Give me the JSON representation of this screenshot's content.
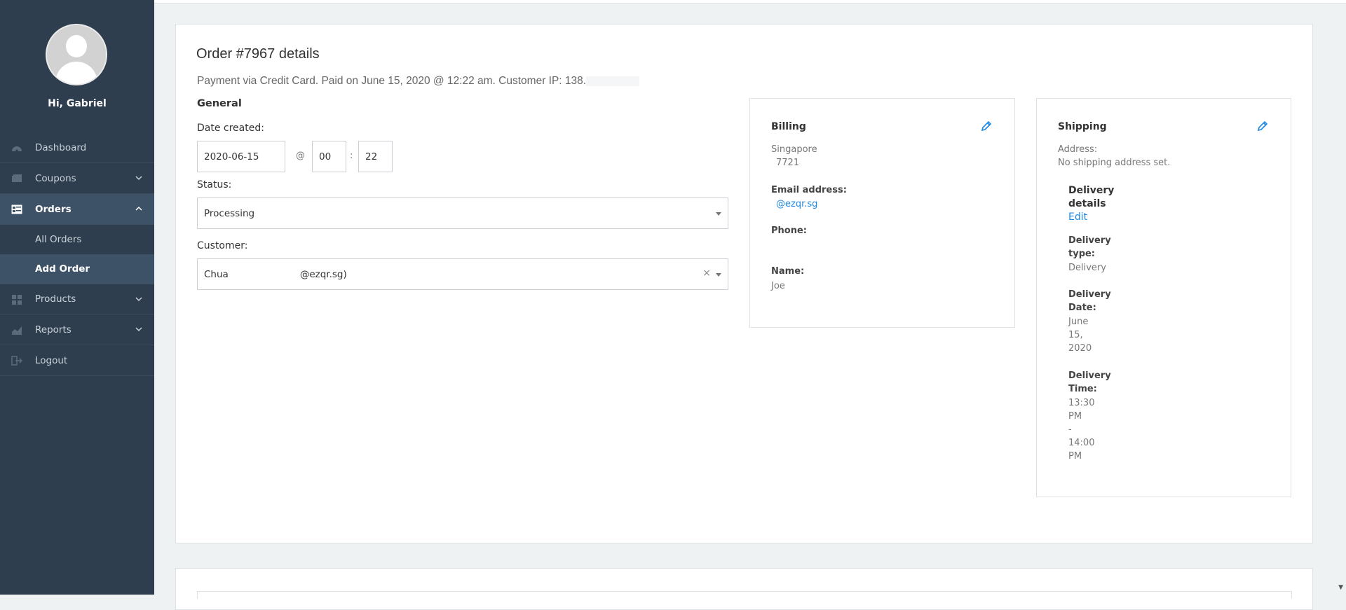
{
  "sidebar": {
    "greeting": "Hi, Gabriel",
    "items": [
      {
        "label": "Dashboard",
        "icon": "dashboard-icon"
      },
      {
        "label": "Coupons",
        "icon": "coupons-icon",
        "expandable": true
      },
      {
        "label": "Orders",
        "icon": "orders-icon",
        "expandable": true,
        "active": true,
        "sub": [
          {
            "label": "All Orders"
          },
          {
            "label": "Add Order",
            "active": true
          }
        ]
      },
      {
        "label": "Products",
        "icon": "products-icon",
        "expandable": true
      },
      {
        "label": "Reports",
        "icon": "reports-icon",
        "expandable": true
      },
      {
        "label": "Logout",
        "icon": "logout-icon"
      }
    ]
  },
  "order": {
    "title": "Order #7967 details",
    "subtitle": "Payment via Credit Card. Paid on June 15, 2020 @ 12:22 am. Customer IP: 138.",
    "general_heading": "General",
    "date_created_label": "Date created:",
    "date_value": "2020-06-15",
    "at_symbol": "@",
    "hour_value": "00",
    "colon": ":",
    "minute_value": "22",
    "status_label": "Status:",
    "status_value": "Processing",
    "customer_label": "Customer:",
    "customer_name": "Chua",
    "customer_email_fragment": "@ezqr.sg)",
    "clear_symbol": "×"
  },
  "billing": {
    "title": "Billing",
    "address_line1": "Singapore",
    "address_line2": "7721",
    "email_label": "Email address:",
    "email_value": "@ezqr.sg",
    "phone_label": "Phone:",
    "name_label": "Name:",
    "name_value": "Joe"
  },
  "shipping": {
    "title": "Shipping",
    "address_label": "Address:",
    "address_value": "No shipping address set.",
    "delivery_details_l1": "Delivery",
    "delivery_details_l2": "details",
    "edit_link": "Edit",
    "type_label_l1": "Delivery",
    "type_label_l2": "type:",
    "type_value": "Delivery",
    "date_label_l1": "Delivery",
    "date_label_l2": "Date:",
    "date_value_l1": "June",
    "date_value_l2": "15,",
    "date_value_l3": "2020",
    "time_label_l1": "Delivery",
    "time_label_l2": "Time:",
    "time_l1": "13:30",
    "time_l2": "PM",
    "time_l3": "-",
    "time_l4": "14:00",
    "time_l5": "PM"
  },
  "colors": {
    "sidebar_bg": "#2e3e4e",
    "sidebar_active": "#3d5167",
    "link": "#1e88e5"
  }
}
